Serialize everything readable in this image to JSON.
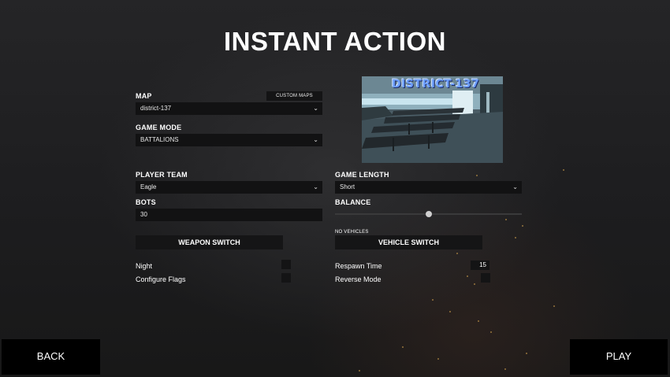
{
  "title": "INSTANT ACTION",
  "map": {
    "label": "MAP",
    "value": "district-137",
    "custom_maps_label": "CUSTOM MAPS",
    "preview_text": "DISTRICT-137"
  },
  "game_mode": {
    "label": "GAME MODE",
    "value": "BATTALIONS"
  },
  "player_team": {
    "label": "PLAYER TEAM",
    "value": "Eagle"
  },
  "game_length": {
    "label": "GAME LENGTH",
    "value": "Short"
  },
  "bots": {
    "label": "BOTS",
    "value": "30"
  },
  "balance": {
    "label": "BALANCE",
    "value": 0.5
  },
  "weapon_switch_label": "WEAPON SWITCH",
  "vehicle_switch_label": "VEHICLE SWITCH",
  "no_vehicles_label": "NO VEHICLES",
  "toggles": {
    "night": "Night",
    "configure_flags": "Configure Flags",
    "respawn_time": "Respawn Time",
    "respawn_time_value": "15",
    "reverse_mode": "Reverse Mode"
  },
  "footer": {
    "back": "BACK",
    "play": "PLAY"
  },
  "colors": {
    "background": "#1d1d1f",
    "panel": "#121213",
    "accent_sparks": "#c89a4a"
  },
  "icons": {
    "dropdown": "chevron-down-icon"
  }
}
